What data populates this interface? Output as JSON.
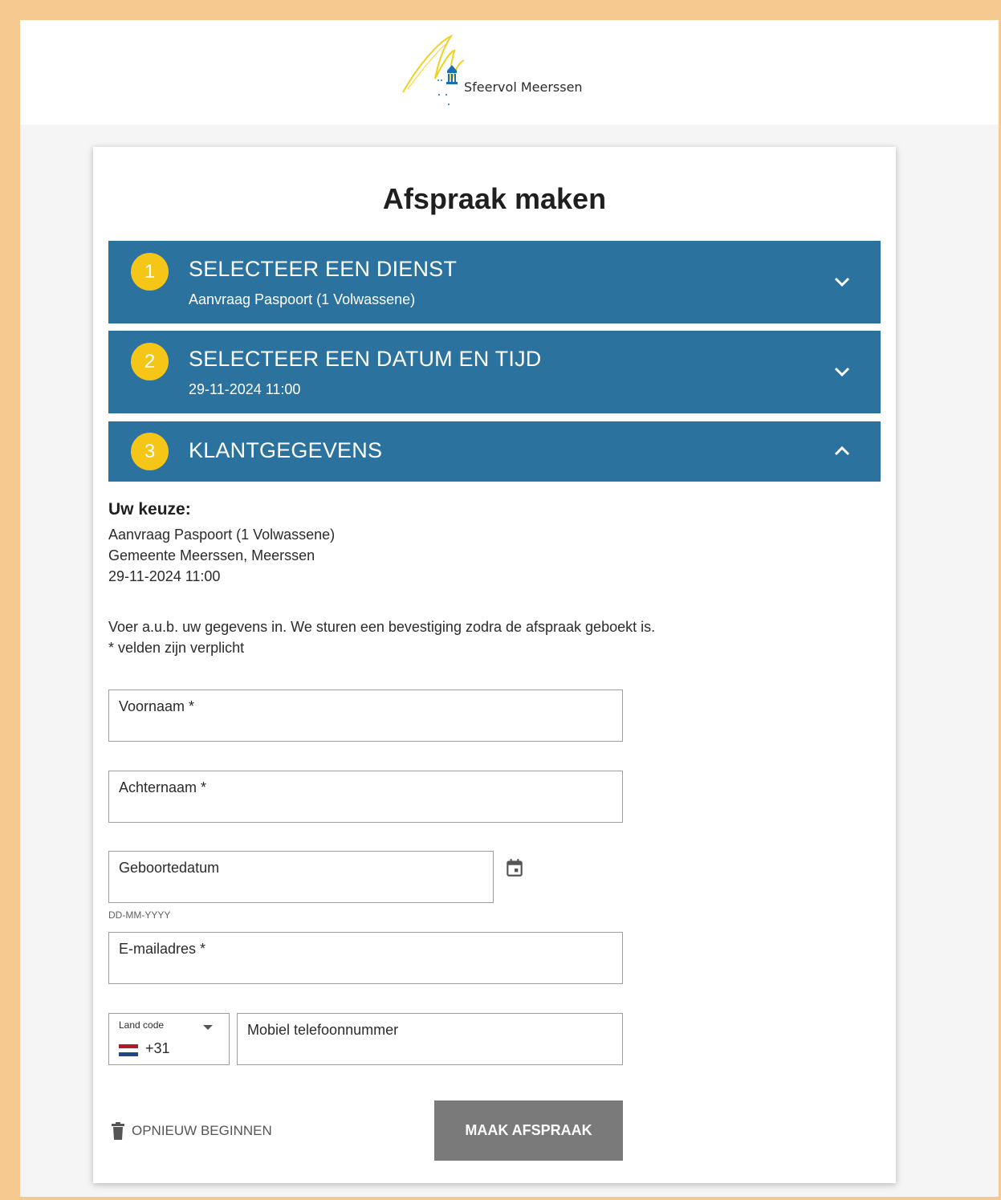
{
  "brand": {
    "name": "Sfeervol Meerssen"
  },
  "page": {
    "title": "Afspraak maken"
  },
  "steps": [
    {
      "number": "1",
      "title": "SELECTEER EEN DIENST",
      "subtitle": "Aanvraag Paspoort (1 Volwassene)",
      "state": "collapsed",
      "chevron_icon": "chevron-down-icon"
    },
    {
      "number": "2",
      "title": "SELECTEER EEN DATUM EN TIJD",
      "subtitle": "29-11-2024 11:00",
      "state": "collapsed",
      "chevron_icon": "chevron-down-icon"
    },
    {
      "number": "3",
      "title": "KLANTGEGEVENS",
      "state": "expanded",
      "chevron_icon": "chevron-up-icon"
    }
  ],
  "choice": {
    "heading": "Uw keuze:",
    "lines": [
      "Aanvraag Paspoort (1 Volwassene)",
      "Gemeente Meerssen, Meerssen",
      "29-11-2024 11:00"
    ]
  },
  "instructions": {
    "line1": "Voer a.u.b. uw gegevens in. We sturen een bevestiging zodra de afspraak geboekt is.",
    "line2": "* velden zijn verplicht"
  },
  "form": {
    "firstname_label": "Voornaam *",
    "lastname_label": "Achternaam *",
    "birthdate_label": "Geboortedatum",
    "birthdate_hint": "DD-MM-YYYY",
    "email_label": "E-mailadres *",
    "country_code_label": "Land code",
    "country_code_value": "+31",
    "phone_label": "Mobiel telefoonnummer"
  },
  "actions": {
    "restart_label": "OPNIEUW BEGINNEN",
    "submit_label": "MAAK AFSPRAAK"
  },
  "colors": {
    "step_bar": "#2b729f",
    "step_badge": "#f5c518",
    "submit_disabled": "#7a7a7a",
    "frame_border": "#f5c990"
  }
}
